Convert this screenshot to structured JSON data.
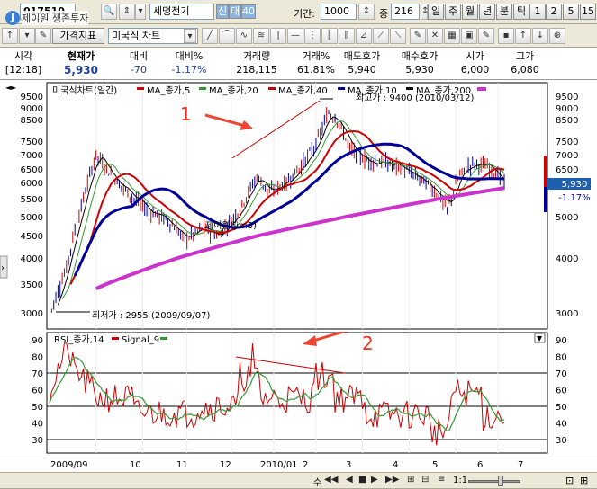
{
  "toolbar1": {
    "code": "017510",
    "company": "세명전기",
    "badge1": "신",
    "badge2": "대",
    "badge3": "40",
    "period_label": "기간:",
    "period_value": "1000",
    "count_label": "중",
    "count_value": "216",
    "tf_buttons": [
      "일",
      "주",
      "월",
      "년",
      "분",
      "틱",
      "1",
      "2",
      "5",
      "15"
    ]
  },
  "toolbar2": {
    "price_index": "가격지표",
    "chart_type": "미국식 차트"
  },
  "watermark": "제이원 생존투자",
  "quote": {
    "headers": [
      "시각",
      "현재가",
      "대비",
      "대비%",
      "거래량",
      "거래%",
      "매도호가",
      "매수호가",
      "시가",
      "고가"
    ],
    "values": [
      "[12:18]",
      "5,930",
      "-70",
      "-1.17%",
      "218,115",
      "61.81%",
      "5,940",
      "5,930",
      "6,000",
      "6,080"
    ]
  },
  "price_chart": {
    "legend": "미국식차트(일간)",
    "ma5": "MA_종가,5",
    "ma20": "MA_종가,20",
    "ma40": "MA_종가,40",
    "ma10": "MA_종가,10",
    "ma200": "MA_종가,200",
    "high_label": "최고가 : 9400 (2010/03/12)",
    "low_label": "최저가 : 2955 (2009/09/07)",
    "current_price": "5,930",
    "current_change": "-1.17%",
    "y_ticks_left": [
      "9500",
      "9000",
      "8500",
      "7500",
      "7000",
      "6500",
      "6000",
      "5500",
      "5000",
      "4500",
      "4000",
      "3500",
      "3000"
    ],
    "y_ticks_right": [
      "9500",
      "9000",
      "8500",
      "7500",
      "7000",
      "6500",
      "6000",
      "5000",
      "4000",
      "3000"
    ],
    "annotation1": "1",
    "watermark2": "제이원(jim3)"
  },
  "rsi_chart": {
    "legend_rsi": "RSI_종가,14",
    "legend_signal": "Signal_9",
    "y_ticks": [
      "90",
      "80",
      "70",
      "60",
      "50",
      "40",
      "30"
    ],
    "annotation2": "2"
  },
  "x_axis": {
    "labels": [
      "2009/09",
      "10",
      "11",
      "12",
      "2010/01",
      "2",
      "3",
      "4",
      "5",
      "6",
      "7"
    ]
  },
  "bottom_bar": {
    "zoom": "1:1"
  },
  "colors": {
    "ma5": "#cc0000",
    "ma20": "#339933",
    "ma40": "#cc0000",
    "ma10": "#000099",
    "ma200": "#cc33cc",
    "up": "#cc0000",
    "down": "#000099",
    "accent": "#2b5797"
  }
}
